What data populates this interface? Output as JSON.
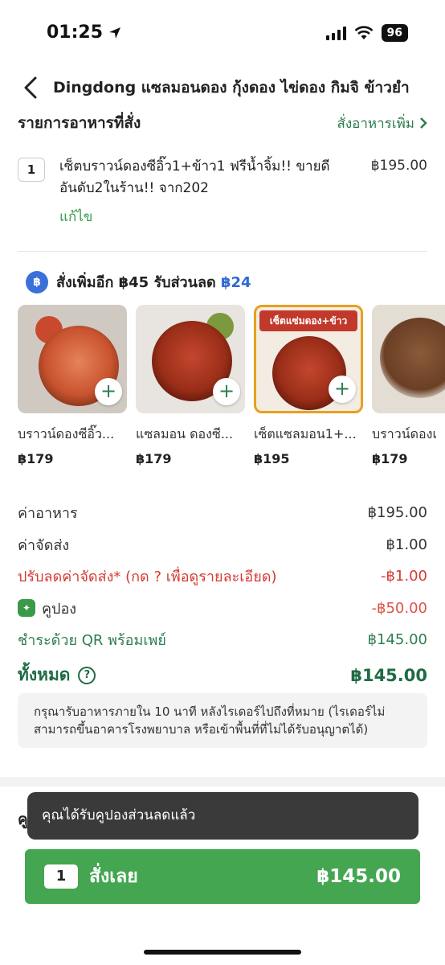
{
  "status_bar": {
    "time": "01:25",
    "battery": "96"
  },
  "header": {
    "title": "Dingdong แซลมอนดอง กุ้งดอง ไข่ดอง กิมจิ ข้าวยำ"
  },
  "order_section": {
    "title": "รายการอาหารที่สั่ง",
    "add_more": "สั่งอาหารเพิ่ม"
  },
  "cart_item": {
    "qty": "1",
    "name": "เซ็ตบราวน์ดองซีอิ๊ว1+ข้าว1 ฟรีน้ำจิ้ม!! ขายดีอันดับ2ในร้าน!! จาก202",
    "price": "฿195.00",
    "edit": "แก้ไข"
  },
  "upsell": {
    "prefix": "สั่งเพิ่มอีก ฿45 รับส่วนลด ",
    "discount": "฿24",
    "items": [
      {
        "name": "บราวน์ดองซีอิ๊ว...",
        "price": "฿179"
      },
      {
        "name": "แซลมอน ดองซี...",
        "price": "฿179"
      },
      {
        "name": "เซ็ตแซลมอน1+...",
        "price": "฿195",
        "banner": "เซ็ตแซ่มดอง+ข้าว"
      },
      {
        "name": "บราวน์ดองเ",
        "price": "฿179"
      }
    ]
  },
  "summary": {
    "food_label": "ค่าอาหาร",
    "food_value": "฿195.00",
    "delivery_label": "ค่าจัดส่ง",
    "delivery_value": "฿1.00",
    "delivery_discount_label": "ปรับลดค่าจัดส่ง* (กด ? เพื่อดูรายละเอียด)",
    "delivery_discount_value": "-฿1.00",
    "coupon_label": "คูปอง",
    "coupon_value": "-฿50.00",
    "payment_label": "ชำระด้วย QR พร้อมเพย์",
    "payment_value": "฿145.00",
    "total_label": "ทั้งหมด",
    "total_value": "฿145.00"
  },
  "notice": "กรุณารับอาหารภายใน 10 นาที หลังไรเดอร์ไปถึงที่หมาย (ไรเดอร์ไม่สามารถขึ้นอาคารโรงพยาบาล หรือเข้าพื้นที่ที่ไม่ได้รับอนุญาตได้)",
  "hidden_section_initial": "คู",
  "toast": "คุณได้รับคูปองส่วนลดแล้ว",
  "order_button": {
    "qty": "1",
    "label": "สั่งเลย",
    "total": "฿145.00"
  },
  "colors": {
    "brand_green": "#44a651",
    "dark_green": "#1f6b44",
    "discount_red": "#d43a32",
    "accent_blue": "#2f6ad4"
  }
}
